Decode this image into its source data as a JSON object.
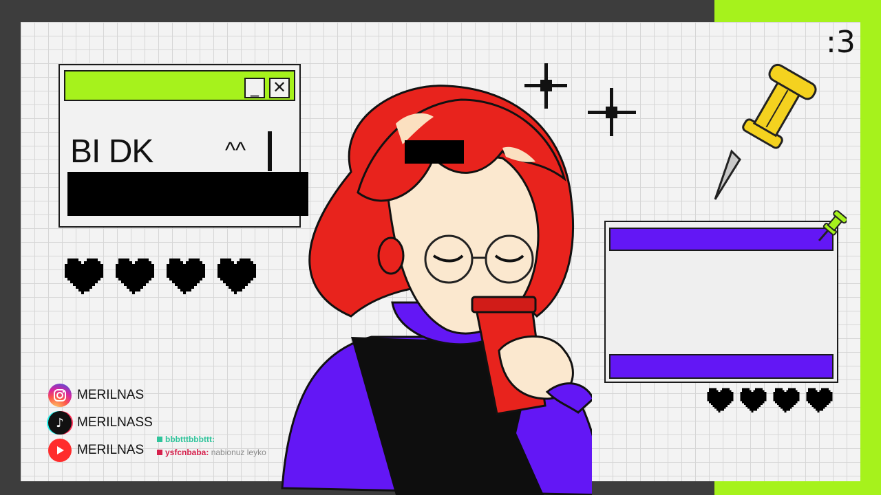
{
  "overlay": {
    "left_window": {
      "line1": "BI DK",
      "emote": "^^",
      "minimize_glyph": "_",
      "close_glyph": "✕"
    },
    "corner_text": ":3",
    "hearts_left_count": 4,
    "hearts_right_count": 4
  },
  "socials": [
    {
      "platform": "instagram",
      "icon": "instagram-icon",
      "handle": "MERILNAS",
      "color": "#e1306c"
    },
    {
      "platform": "tiktok",
      "icon": "tiktok-icon",
      "handle": "MERILNASS",
      "color": "#111111"
    },
    {
      "platform": "youtube",
      "icon": "youtube-icon",
      "handle": "MERILNAS",
      "color": "#ff2c2c"
    }
  ],
  "chat": {
    "messages": [
      {
        "user": "bbbtttbbbttt:",
        "text": "",
        "color": "#2fc49b"
      },
      {
        "user": "ysfcnbaba:",
        "text": "nabionuz leyko",
        "color": "#d6204c"
      }
    ]
  },
  "colors": {
    "accent_green": "#a6f21c",
    "accent_purple": "#6317f5",
    "hair_red": "#e8231d"
  }
}
